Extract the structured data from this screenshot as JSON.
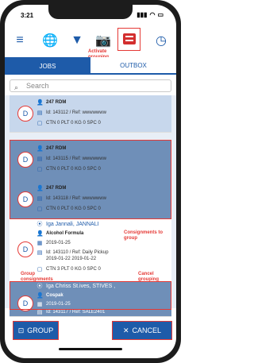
{
  "status": {
    "time": "3:21"
  },
  "tabs": {
    "jobs": "JOBS",
    "outbox": "OUTBOX"
  },
  "search": {
    "placeholder": "Search"
  },
  "annotations": {
    "activate": "Activate grouping",
    "consignments": "Consignments to group",
    "group_consignments": "Group consignments",
    "cancel_grouping": "Cancel grouping"
  },
  "rows": [
    {
      "badge": "D",
      "name": "247 RDM",
      "id": "Id: 143112 / Ref: wwwwwww",
      "ctn": "CTN 0 PLT 0 KG 0 SPC 0"
    },
    {
      "badge": "D",
      "name": "247 RDM",
      "id": "Id: 143115 / Ref: wwwwwww",
      "ctn": "CTN 0 PLT 0 KG 0 SPC 0"
    },
    {
      "badge": "D",
      "name": "247 RDM",
      "id": "Id: 143118 / Ref: wwwwwww",
      "ctn": "CTN 0 PLT 0 KG 0 SPC 0"
    },
    {
      "badge": "D",
      "place": "Iga Jannali, JANNALI",
      "name": "Alcohol Formula",
      "date": "2019-01-25",
      "id": "Id: 143110 / Ref: Daily Pickup",
      "id2": "2019-01-22 2019-01-22",
      "ctn": "CTN 3 PLT 0 KG 0 SPC 0"
    },
    {
      "badge": "D",
      "place": "Iga Chriss St.ives, STIVES ,",
      "name": "Cospak",
      "date": "2019-01-25",
      "id": "Id: 143117 / Ref: SALE2401"
    }
  ],
  "buttons": {
    "group": "GROUP",
    "cancel": "CANCEL"
  }
}
